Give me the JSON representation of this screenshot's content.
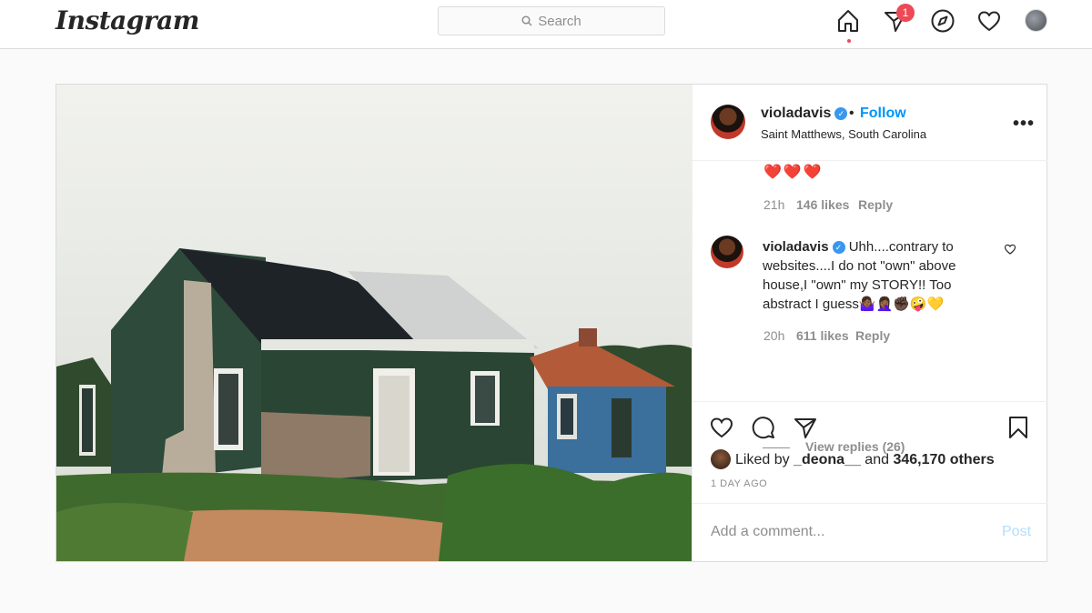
{
  "nav": {
    "logo": "Instagram",
    "search_placeholder": "Search",
    "activity_badge": "1"
  },
  "post": {
    "header": {
      "username": "violadavis",
      "dot": "•",
      "follow_label": "Follow",
      "location": "Saint Matthews, South Carolina",
      "more": "•••"
    },
    "comment1": {
      "text": "❤️❤️❤️",
      "time": "21h",
      "likes": "146 likes",
      "reply": "Reply"
    },
    "comment2": {
      "username": "violadavis",
      "text": "Uhh....contrary to websites....I do not \"own\" above house,I \"own\" my STORY!! Too abstract I guess🤷🏾‍♀️🤦🏾‍♀️✊🏿🤪💛",
      "time": "20h",
      "likes": "611 likes",
      "reply": "Reply",
      "view_replies": "View replies (26)"
    },
    "liked_by": {
      "prefix": "Liked by ",
      "user": "_deona__",
      "middle": " and ",
      "others": "346,170 others"
    },
    "time_ago": "1 DAY AGO",
    "add_comment_placeholder": "Add a comment...",
    "post_button": "Post"
  },
  "colors": {
    "link_blue": "#0095f6",
    "badge_red": "#ed4956",
    "muted": "#8e8e8e",
    "border": "#dbdbdb"
  },
  "icons": [
    "search-icon",
    "home-icon",
    "direct-icon",
    "explore-icon",
    "heart-icon",
    "profile-avatar",
    "verified-icon",
    "more-icon",
    "like-icon",
    "comment-icon",
    "share-icon",
    "save-icon"
  ]
}
